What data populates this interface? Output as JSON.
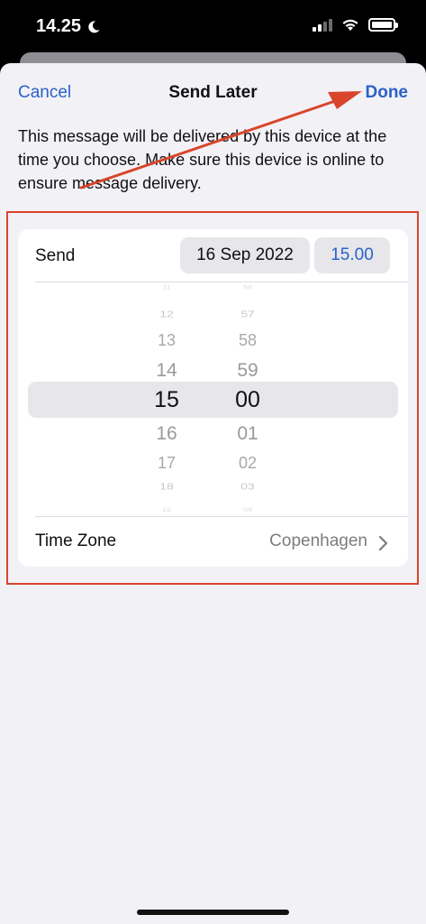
{
  "status_bar": {
    "time": "14.25",
    "icons": [
      "moon-icon",
      "cellular-signal-icon",
      "wifi-icon",
      "battery-icon"
    ]
  },
  "nav": {
    "cancel_label": "Cancel",
    "title": "Send Later",
    "done_label": "Done"
  },
  "description": "This message will be delivered by this device at the time you choose. Make sure this device is online to ensure message delivery.",
  "send_row": {
    "label": "Send",
    "date": "16 Sep 2022",
    "time": "15.00"
  },
  "picker": {
    "hours": [
      "11",
      "12",
      "13",
      "14",
      "15",
      "16",
      "17",
      "18",
      "19"
    ],
    "minutes": [
      "56",
      "57",
      "58",
      "59",
      "00",
      "01",
      "02",
      "03",
      "04"
    ],
    "selected_hour": "15",
    "selected_minute": "00"
  },
  "timezone_row": {
    "label": "Time Zone",
    "value": "Copenhagen"
  },
  "colors": {
    "accent": "#2a62c9",
    "annotation": "#d9452b",
    "sheet_background": "#f2f1f6",
    "card_background": "#ffffff"
  }
}
